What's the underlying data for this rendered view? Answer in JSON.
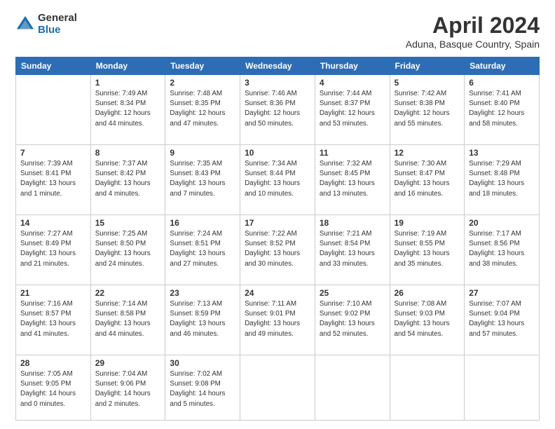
{
  "header": {
    "logo_general": "General",
    "logo_blue": "Blue",
    "title": "April 2024",
    "location": "Aduna, Basque Country, Spain"
  },
  "calendar": {
    "days_of_week": [
      "Sunday",
      "Monday",
      "Tuesday",
      "Wednesday",
      "Thursday",
      "Friday",
      "Saturday"
    ],
    "weeks": [
      [
        {
          "day": "",
          "info": ""
        },
        {
          "day": "1",
          "info": "Sunrise: 7:49 AM\nSunset: 8:34 PM\nDaylight: 12 hours\nand 44 minutes."
        },
        {
          "day": "2",
          "info": "Sunrise: 7:48 AM\nSunset: 8:35 PM\nDaylight: 12 hours\nand 47 minutes."
        },
        {
          "day": "3",
          "info": "Sunrise: 7:46 AM\nSunset: 8:36 PM\nDaylight: 12 hours\nand 50 minutes."
        },
        {
          "day": "4",
          "info": "Sunrise: 7:44 AM\nSunset: 8:37 PM\nDaylight: 12 hours\nand 53 minutes."
        },
        {
          "day": "5",
          "info": "Sunrise: 7:42 AM\nSunset: 8:38 PM\nDaylight: 12 hours\nand 55 minutes."
        },
        {
          "day": "6",
          "info": "Sunrise: 7:41 AM\nSunset: 8:40 PM\nDaylight: 12 hours\nand 58 minutes."
        }
      ],
      [
        {
          "day": "7",
          "info": "Sunrise: 7:39 AM\nSunset: 8:41 PM\nDaylight: 13 hours\nand 1 minute."
        },
        {
          "day": "8",
          "info": "Sunrise: 7:37 AM\nSunset: 8:42 PM\nDaylight: 13 hours\nand 4 minutes."
        },
        {
          "day": "9",
          "info": "Sunrise: 7:35 AM\nSunset: 8:43 PM\nDaylight: 13 hours\nand 7 minutes."
        },
        {
          "day": "10",
          "info": "Sunrise: 7:34 AM\nSunset: 8:44 PM\nDaylight: 13 hours\nand 10 minutes."
        },
        {
          "day": "11",
          "info": "Sunrise: 7:32 AM\nSunset: 8:45 PM\nDaylight: 13 hours\nand 13 minutes."
        },
        {
          "day": "12",
          "info": "Sunrise: 7:30 AM\nSunset: 8:47 PM\nDaylight: 13 hours\nand 16 minutes."
        },
        {
          "day": "13",
          "info": "Sunrise: 7:29 AM\nSunset: 8:48 PM\nDaylight: 13 hours\nand 18 minutes."
        }
      ],
      [
        {
          "day": "14",
          "info": "Sunrise: 7:27 AM\nSunset: 8:49 PM\nDaylight: 13 hours\nand 21 minutes."
        },
        {
          "day": "15",
          "info": "Sunrise: 7:25 AM\nSunset: 8:50 PM\nDaylight: 13 hours\nand 24 minutes."
        },
        {
          "day": "16",
          "info": "Sunrise: 7:24 AM\nSunset: 8:51 PM\nDaylight: 13 hours\nand 27 minutes."
        },
        {
          "day": "17",
          "info": "Sunrise: 7:22 AM\nSunset: 8:52 PM\nDaylight: 13 hours\nand 30 minutes."
        },
        {
          "day": "18",
          "info": "Sunrise: 7:21 AM\nSunset: 8:54 PM\nDaylight: 13 hours\nand 33 minutes."
        },
        {
          "day": "19",
          "info": "Sunrise: 7:19 AM\nSunset: 8:55 PM\nDaylight: 13 hours\nand 35 minutes."
        },
        {
          "day": "20",
          "info": "Sunrise: 7:17 AM\nSunset: 8:56 PM\nDaylight: 13 hours\nand 38 minutes."
        }
      ],
      [
        {
          "day": "21",
          "info": "Sunrise: 7:16 AM\nSunset: 8:57 PM\nDaylight: 13 hours\nand 41 minutes."
        },
        {
          "day": "22",
          "info": "Sunrise: 7:14 AM\nSunset: 8:58 PM\nDaylight: 13 hours\nand 44 minutes."
        },
        {
          "day": "23",
          "info": "Sunrise: 7:13 AM\nSunset: 8:59 PM\nDaylight: 13 hours\nand 46 minutes."
        },
        {
          "day": "24",
          "info": "Sunrise: 7:11 AM\nSunset: 9:01 PM\nDaylight: 13 hours\nand 49 minutes."
        },
        {
          "day": "25",
          "info": "Sunrise: 7:10 AM\nSunset: 9:02 PM\nDaylight: 13 hours\nand 52 minutes."
        },
        {
          "day": "26",
          "info": "Sunrise: 7:08 AM\nSunset: 9:03 PM\nDaylight: 13 hours\nand 54 minutes."
        },
        {
          "day": "27",
          "info": "Sunrise: 7:07 AM\nSunset: 9:04 PM\nDaylight: 13 hours\nand 57 minutes."
        }
      ],
      [
        {
          "day": "28",
          "info": "Sunrise: 7:05 AM\nSunset: 9:05 PM\nDaylight: 14 hours\nand 0 minutes."
        },
        {
          "day": "29",
          "info": "Sunrise: 7:04 AM\nSunset: 9:06 PM\nDaylight: 14 hours\nand 2 minutes."
        },
        {
          "day": "30",
          "info": "Sunrise: 7:02 AM\nSunset: 9:08 PM\nDaylight: 14 hours\nand 5 minutes."
        },
        {
          "day": "",
          "info": ""
        },
        {
          "day": "",
          "info": ""
        },
        {
          "day": "",
          "info": ""
        },
        {
          "day": "",
          "info": ""
        }
      ]
    ]
  }
}
